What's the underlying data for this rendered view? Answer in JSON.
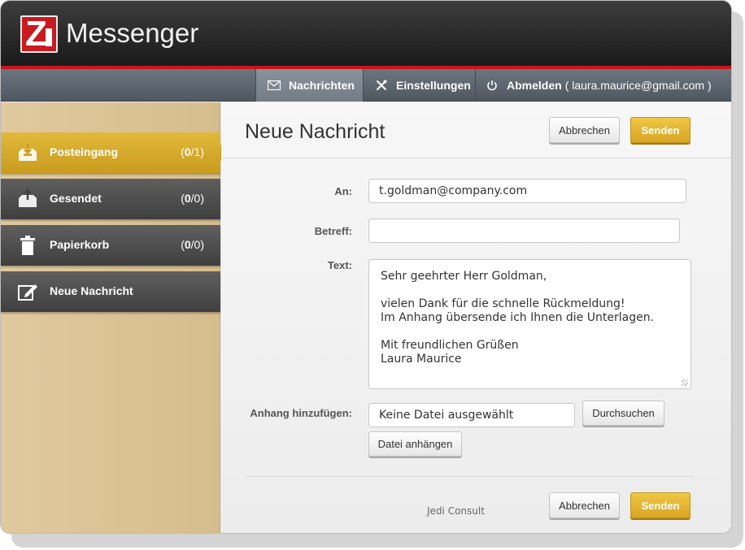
{
  "app": {
    "title": "Messenger",
    "logo_letter": "Z"
  },
  "nav": {
    "messages": "Nachrichten",
    "settings": "Einstellungen",
    "logout": "Abmelden",
    "user_email": "( laura.maurice@gmail.com )"
  },
  "sidebar": {
    "items": [
      {
        "label": "Posteingang",
        "count_bold": "0",
        "count_rest": "/1)",
        "count_open": "(",
        "active": true
      },
      {
        "label": "Gesendet",
        "count_bold": "0",
        "count_rest": "/0)",
        "count_open": "("
      },
      {
        "label": "Papierkorb",
        "count_bold": "0",
        "count_rest": "/0)",
        "count_open": "("
      },
      {
        "label": "Neue Nachricht"
      }
    ]
  },
  "main": {
    "title": "Neue Nachricht",
    "cancel_label": "Abbrechen",
    "send_label": "Senden",
    "to_label": "An:",
    "to_value": "t.goldman@company.com",
    "subject_label": "Betreff:",
    "subject_value": "",
    "text_label": "Text:",
    "text_lines": [
      "Sehr geehrter Herr Goldman,",
      "",
      "vielen Dank für die schnelle Rückmeldung!",
      "Im Anhang übersende ich Ihnen die Unterlagen.",
      "",
      "Mit freundlichen Grüßen",
      "Laura Maurice"
    ],
    "attach_label": "Anhang hinzufügen:",
    "file_value": "Keine Datei ausgewählt",
    "browse_label": "Durchsuchen",
    "attach_button": "Datei anhängen",
    "footer_brand": "Jedi Consult"
  },
  "colors": {
    "accent": "#d8a523",
    "brand_red": "#c81a1f",
    "header": "#1f1f1f"
  }
}
